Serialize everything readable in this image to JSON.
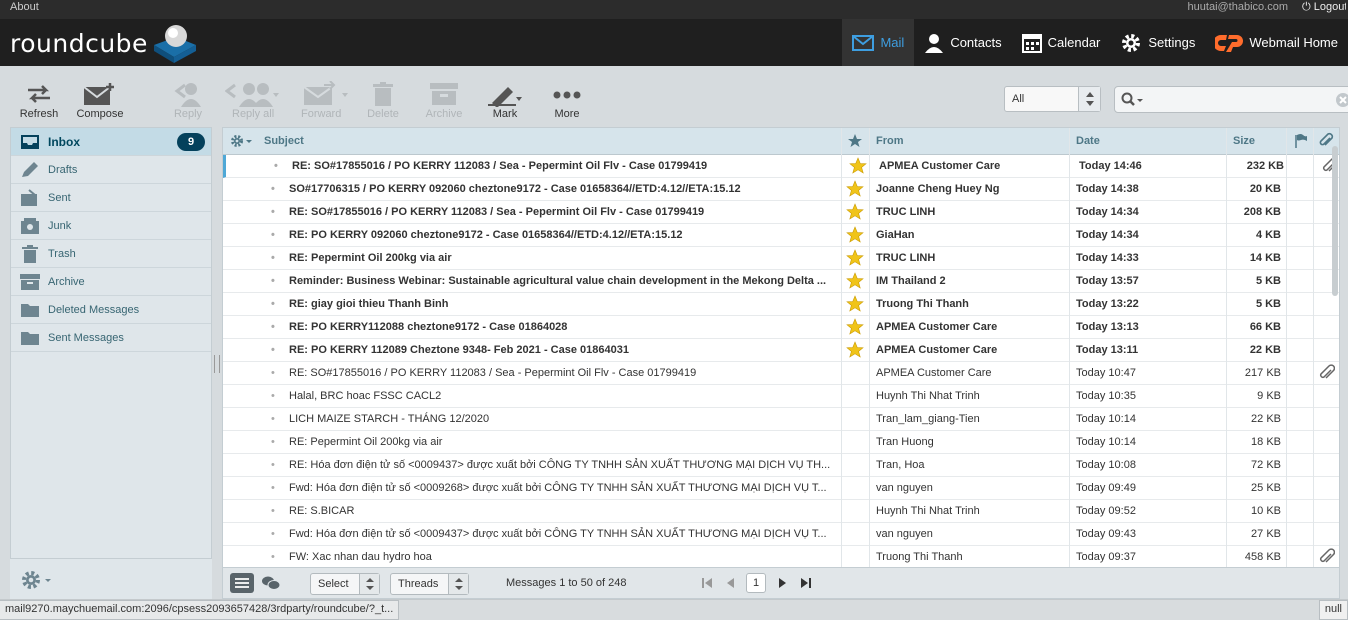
{
  "top": {
    "about": "About",
    "user": "huutai@thabico.com",
    "logout": "Logout"
  },
  "brand": "roundcube",
  "nav": [
    {
      "label": "Mail"
    },
    {
      "label": "Contacts"
    },
    {
      "label": "Calendar"
    },
    {
      "label": "Settings"
    },
    {
      "label": "Webmail Home"
    }
  ],
  "toolbar": {
    "refresh": "Refresh",
    "compose": "Compose",
    "reply": "Reply",
    "reply_all": "Reply all",
    "forward": "Forward",
    "delete": "Delete",
    "archive": "Archive",
    "mark": "Mark",
    "more": "More"
  },
  "filter": {
    "selected": "All"
  },
  "search": {
    "placeholder": ""
  },
  "folders": [
    {
      "name": "Inbox",
      "unread": "9",
      "icon": "inbox-icon"
    },
    {
      "name": "Drafts",
      "icon": "pencil-icon"
    },
    {
      "name": "Sent",
      "icon": "sent-icon"
    },
    {
      "name": "Junk",
      "icon": "junk-icon"
    },
    {
      "name": "Trash",
      "icon": "trash-icon"
    },
    {
      "name": "Archive",
      "icon": "archive-icon"
    },
    {
      "name": "Deleted Messages",
      "icon": "folder-icon"
    },
    {
      "name": "Sent Messages",
      "icon": "folder-icon"
    }
  ],
  "columns": {
    "subject": "Subject",
    "from": "From",
    "date": "Date",
    "size": "Size"
  },
  "messages": [
    {
      "subject": "RE: SO#17855016 / PO KERRY 112083 / Sea - Pepermint Oil Flv - Case 01799419",
      "from": "APMEA Customer Care",
      "date": "Today 14:46",
      "size": "232 KB",
      "unread": true,
      "flagged": true,
      "attachment": true
    },
    {
      "subject": "SO#17706315 / PO KERRY 092060 cheztone9172 - Case 01658364//ETD:4.12//ETA:15.12",
      "from": "Joanne Cheng Huey Ng",
      "date": "Today 14:38",
      "size": "20 KB",
      "unread": true,
      "flagged": true,
      "attachment": false
    },
    {
      "subject": "RE: SO#17855016 / PO KERRY 112083 / Sea - Pepermint Oil Flv - Case 01799419",
      "from": "TRUC LINH",
      "date": "Today 14:34",
      "size": "208 KB",
      "unread": true,
      "flagged": true,
      "attachment": false
    },
    {
      "subject": "RE: PO KERRY 092060 cheztone9172 - Case 01658364//ETD:4.12//ETA:15.12",
      "from": "GiaHan",
      "date": "Today 14:34",
      "size": "4 KB",
      "unread": true,
      "flagged": true,
      "attachment": false
    },
    {
      "subject": "RE: Pepermint Oil 200kg via air",
      "from": "TRUC LINH",
      "date": "Today 14:33",
      "size": "14 KB",
      "unread": true,
      "flagged": true,
      "attachment": false
    },
    {
      "subject": "Reminder: Business Webinar: Sustainable agricultural value chain development in the Mekong Delta ...",
      "from": "IM Thailand 2",
      "date": "Today 13:57",
      "size": "5 KB",
      "unread": true,
      "flagged": true,
      "attachment": false
    },
    {
      "subject": "RE: giay gioi thieu Thanh Binh",
      "from": "Truong Thi Thanh",
      "date": "Today 13:22",
      "size": "5 KB",
      "unread": true,
      "flagged": true,
      "attachment": false
    },
    {
      "subject": "RE: PO KERRY112088 cheztone9172 - Case 01864028",
      "from": "APMEA Customer Care",
      "date": "Today 13:13",
      "size": "66 KB",
      "unread": true,
      "flagged": true,
      "attachment": false
    },
    {
      "subject": "RE: PO KERRY 112089 Cheztone 9348- Feb 2021 - Case 01864031",
      "from": "APMEA Customer Care",
      "date": "Today 13:11",
      "size": "22 KB",
      "unread": true,
      "flagged": true,
      "attachment": false
    },
    {
      "subject": "RE: SO#17855016 / PO KERRY 112083 / Sea - Pepermint Oil Flv - Case 01799419",
      "from": "APMEA Customer Care",
      "date": "Today 10:47",
      "size": "217 KB",
      "unread": false,
      "flagged": false,
      "attachment": true
    },
    {
      "subject": "Halal, BRC hoac FSSC CACL2",
      "from": "Huynh Thi Nhat Trinh",
      "date": "Today 10:35",
      "size": "9 KB",
      "unread": false,
      "flagged": false,
      "attachment": false
    },
    {
      "subject": "LICH MAIZE STARCH - THÁNG 12/2020",
      "from": "Tran_lam_giang-Tien",
      "date": "Today 10:14",
      "size": "22 KB",
      "unread": false,
      "flagged": false,
      "attachment": false
    },
    {
      "subject": "RE: Pepermint Oil 200kg via air",
      "from": "Tran Huong",
      "date": "Today 10:14",
      "size": "18 KB",
      "unread": false,
      "flagged": false,
      "attachment": false
    },
    {
      "subject": "RE: Hóa đơn điện tử số <0009437> được xuất bởi CÔNG TY TNHH SẢN XUẤT THƯƠNG MẠI DỊCH VỤ TH...",
      "from": "Tran, Hoa",
      "date": "Today 10:08",
      "size": "72 KB",
      "unread": false,
      "flagged": false,
      "attachment": false
    },
    {
      "subject": "Fwd: Hóa đơn điện tử số <0009268> được xuất bởi CÔNG TY TNHH SẢN XUẤT THƯƠNG MẠI DỊCH VỤ T...",
      "from": "van nguyen",
      "date": "Today 09:49",
      "size": "25 KB",
      "unread": false,
      "flagged": false,
      "attachment": false
    },
    {
      "subject": "RE: S.BICAR",
      "from": "Huynh Thi Nhat Trinh",
      "date": "Today 09:52",
      "size": "10 KB",
      "unread": false,
      "flagged": false,
      "attachment": false
    },
    {
      "subject": "Fwd: Hóa đơn điện tử số <0009437> được xuất bởi CÔNG TY TNHH SẢN XUẤT THƯƠNG MẠI DỊCH VỤ T...",
      "from": "van nguyen",
      "date": "Today 09:43",
      "size": "27 KB",
      "unread": false,
      "flagged": false,
      "attachment": false
    },
    {
      "subject": "FW: Xac nhan dau hydro hoa",
      "from": "Truong Thi Thanh",
      "date": "Today 09:37",
      "size": "458 KB",
      "unread": false,
      "flagged": false,
      "attachment": true
    }
  ],
  "footer": {
    "select": "Select",
    "threads": "Threads",
    "count": "Messages 1 to 50 of 248",
    "page": "1"
  },
  "status": {
    "url": "mail9270.maychuemail.com:2096/cpsess2093657428/3rdparty/roundcube/?_t...",
    "null": "null"
  },
  "colors": {
    "accent": "#3e9ee0",
    "star": "#f0c419",
    "badge": "#04415c"
  }
}
